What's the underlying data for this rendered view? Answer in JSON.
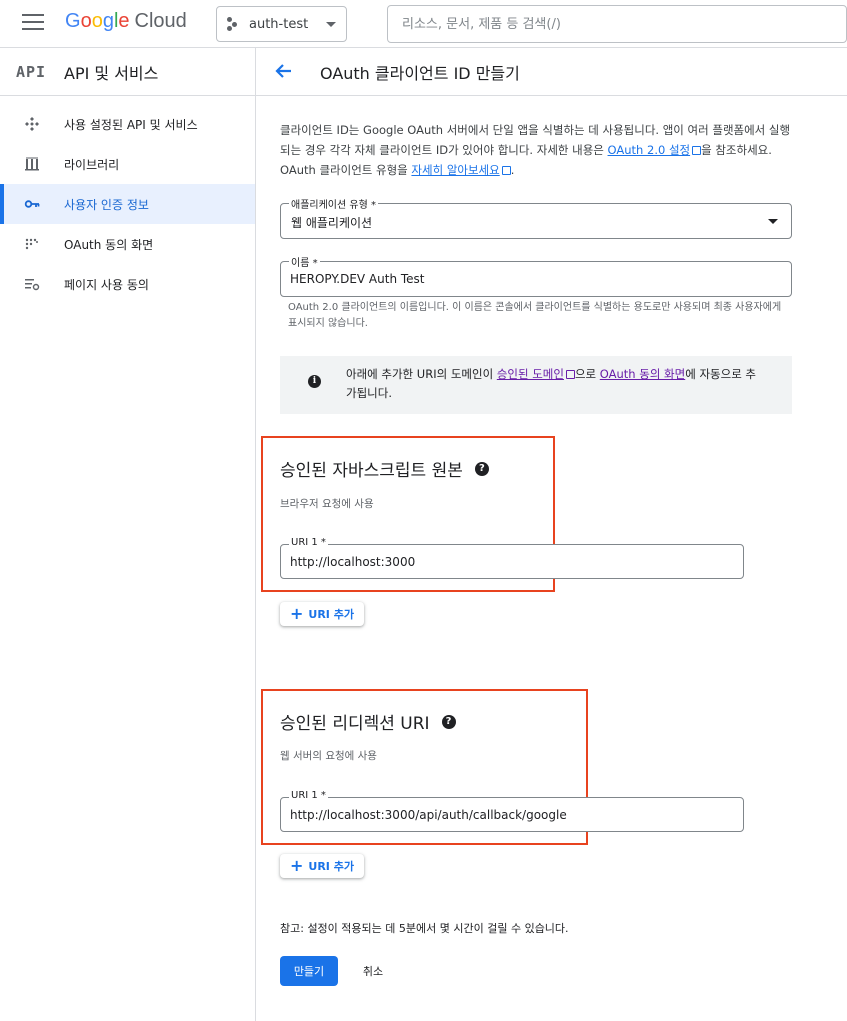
{
  "topbar": {
    "logo_google": [
      "G",
      "o",
      "o",
      "g",
      "l",
      "e"
    ],
    "logo_cloud": "Cloud",
    "project_name": "auth-test",
    "search_placeholder": "리소스, 문서, 제품 등 검색(/)"
  },
  "sidebar": {
    "logo_text": "API",
    "title": "API 및 서비스",
    "items": [
      {
        "label": "사용 설정된 API 및 서비스",
        "icon": "api-hub-icon",
        "active": false
      },
      {
        "label": "라이브러리",
        "icon": "library-icon",
        "active": false
      },
      {
        "label": "사용자 인증 정보",
        "icon": "key-icon",
        "active": true
      },
      {
        "label": "OAuth 동의 화면",
        "icon": "consent-screen-icon",
        "active": false
      },
      {
        "label": "페이지 사용 동의",
        "icon": "settings-list-icon",
        "active": false
      }
    ]
  },
  "page": {
    "title": "OAuth 클라이언트 ID 만들기",
    "intro_1": "클라이언트 ID는 Google OAuth 서버에서 단일 앱을 식별하는 데 사용됩니다. 앱이 여러 플랫폼에서 실행되는 경우 각각 자체 클라이언트 ID가 있어야 합니다. 자세한 내용은 ",
    "intro_link_1": "OAuth 2.0 설정",
    "intro_2": "을 참조하세요. OAuth 클라이언트 유형을 ",
    "intro_link_2": "자세히 알아보세요",
    "intro_3": ".",
    "app_type_label": "애플리케이션 유형 *",
    "app_type_value": "웹 애플리케이션",
    "name_label": "이름 *",
    "name_value": "HEROPY.DEV Auth Test",
    "name_helper": "OAuth 2.0 클라이언트의 이름입니다. 이 이름은 콘솔에서 클라이언트를 식별하는 용도로만 사용되며 최종 사용자에게 표시되지 않습니다.",
    "info_1": "아래에 추가한 URI의 도메인이 ",
    "info_link_1": "승인된 도메인",
    "info_2": "으로 ",
    "info_link_2": "OAuth 동의 화면",
    "info_3": "에 자동으로 추가됩니다.",
    "js_origins": {
      "title": "승인된 자바스크립트 원본",
      "subtitle": "브라우저 요청에 사용",
      "uri_label": "URI 1 *",
      "uri_value": "http://localhost:3000",
      "add_label": "URI 추가"
    },
    "redirect_uris": {
      "title": "승인된 리디렉션 URI",
      "subtitle": "웹 서버의 요청에 사용",
      "uri_label": "URI 1 *",
      "uri_value": "http://localhost:3000/api/auth/callback/google",
      "add_label": "URI 추가"
    },
    "note": "참고: 설정이 적용되는 데 5분에서 몇 시간이 걸릴 수 있습니다.",
    "create_label": "만들기",
    "cancel_label": "취소"
  },
  "colors": {
    "accent": "#1a73e8",
    "highlight": "#e8431f",
    "active_bg": "#e8f0fe"
  }
}
